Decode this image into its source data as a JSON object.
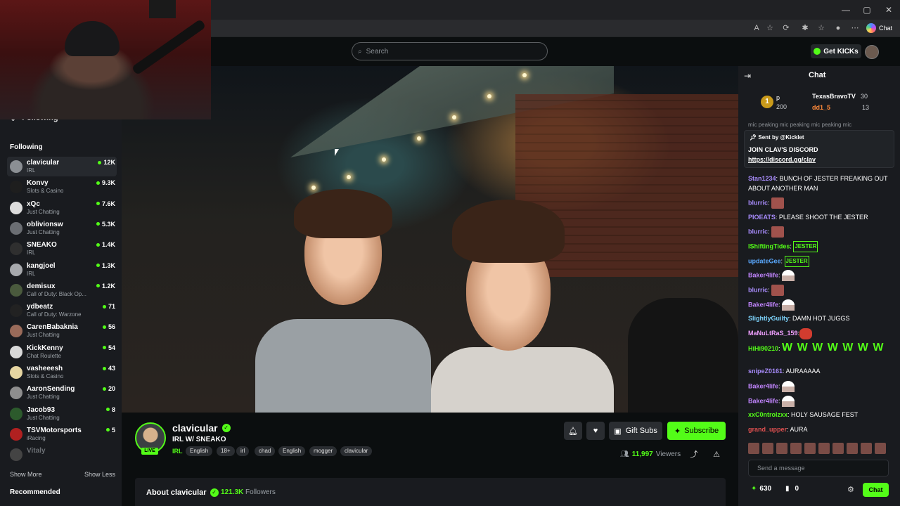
{
  "browser": {
    "window_controls": [
      "—",
      "▢",
      "✕"
    ],
    "chat_label": "Chat"
  },
  "header": {
    "search_placeholder": "Search",
    "get_kicks_label": "Get KICKs"
  },
  "sidebar": {
    "following_header": "Following",
    "following_title": "Following",
    "channels": [
      {
        "name": "clavicular",
        "category": "IRL",
        "viewers": "12K",
        "avatar_color": "#8b8f94"
      },
      {
        "name": "Konvy",
        "category": "Slots & Casino",
        "viewers": "9.3K",
        "avatar_color": "#1e1e1e"
      },
      {
        "name": "xQc",
        "category": "Just Chatting",
        "viewers": "7.6K",
        "avatar_color": "#dcdcdc"
      },
      {
        "name": "oblivionsw",
        "category": "Just Chatting",
        "viewers": "5.3K",
        "avatar_color": "#6b6e73"
      },
      {
        "name": "SNEAKO",
        "category": "IRL",
        "viewers": "1.4K",
        "avatar_color": "#2f2f2f"
      },
      {
        "name": "kangjoel",
        "category": "IRL",
        "viewers": "1.3K",
        "avatar_color": "#a7a9ad"
      },
      {
        "name": "demisux",
        "category": "Call of Duty: Black Op...",
        "viewers": "1.2K",
        "avatar_color": "#4a5a3d"
      },
      {
        "name": "ydbeatz",
        "category": "Call of Duty: Warzone",
        "viewers": "71",
        "avatar_color": "#222"
      },
      {
        "name": "CarenBabaknia",
        "category": "Just Chatting",
        "viewers": "56",
        "avatar_color": "#9a6b5a"
      },
      {
        "name": "KickKenny",
        "category": "Chat Roulette",
        "viewers": "54",
        "avatar_color": "#d9d9d9"
      },
      {
        "name": "vasheeesh",
        "category": "Slots & Casino",
        "viewers": "43",
        "avatar_color": "#e6d6a2"
      },
      {
        "name": "AaronSending",
        "category": "Just Chatting",
        "viewers": "20",
        "avatar_color": "#8e8e8e"
      },
      {
        "name": "Jacob93",
        "category": "Just Chatting",
        "viewers": "8",
        "avatar_color": "#2c5a2c"
      },
      {
        "name": "TSVMotorsports",
        "category": "iRacing",
        "viewers": "5",
        "avatar_color": "#b02020"
      },
      {
        "name": "Vitaly",
        "category": "",
        "viewers": "",
        "avatar_color": "#444"
      }
    ],
    "show_more": "Show More",
    "show_less": "Show Less",
    "recommended": "Recommended"
  },
  "stream": {
    "streamer": "clavicular",
    "live_label": "LIVE",
    "title": "IRL W/ SNEAKO",
    "category": "IRL",
    "tags": [
      "English",
      "18+",
      "irl",
      "chad",
      "English",
      "mogger",
      "clavicular"
    ],
    "gift_subs": "Gift Subs",
    "subscribe": "Subscribe",
    "viewer_count": "11,997",
    "viewer_label": "Viewers",
    "about": "About clavicular",
    "followers_count": "121.3K",
    "followers_label": "Followers"
  },
  "chat": {
    "title": "Chat",
    "leaderboard": {
      "rank": "1",
      "first_user": "p",
      "first_amount": "200",
      "second_user": "TexasBravoTV",
      "second_amount": "30",
      "third_user": "dd1_5",
      "third_amount": "13"
    },
    "peek_text": "mic peaking mic peaking mic peaking mic",
    "pinned": {
      "sent_by": "Sent by",
      "sender": "@Kicklet",
      "message": "JOIN CLAV'S DISCORD",
      "link": "https://discord.gg/clav"
    },
    "messages": [
      {
        "user": "Stan1234",
        "color": "#a78bfa",
        "text": "BUNCH OF JESTER FREAKING OUT ABOUT ANOTHER MAN",
        "emote": ""
      },
      {
        "user": "blurric",
        "color": "#a78bfa",
        "text": "",
        "emote": "red"
      },
      {
        "user": "PIOEATS",
        "color": "#a78bfa",
        "text": "PLEASE SHOOT THE JESTER",
        "emote": ""
      },
      {
        "user": "blurric",
        "color": "#a78bfa",
        "text": "",
        "emote": "red"
      },
      {
        "user": "IShiftingTides",
        "color": "#53fc18",
        "text": "",
        "emote": "jester"
      },
      {
        "user": "updateGee",
        "color": "#5aa9ff",
        "text": "",
        "emote": "jester"
      },
      {
        "user": "Baker4life",
        "color": "#c084fc",
        "text": "",
        "emote": "pale"
      },
      {
        "user": "blurric",
        "color": "#a78bfa",
        "text": "",
        "emote": "red"
      },
      {
        "user": "Baker4life",
        "color": "#c084fc",
        "text": "",
        "emote": "pale"
      },
      {
        "user": "SlightlyGuilty",
        "color": "#7dd3fc",
        "text": "DAMN HOT JUGGS",
        "emote": ""
      },
      {
        "user": "MaNuLtRaS_159",
        "color": "#f0a0ff",
        "text": "",
        "emote": "face"
      },
      {
        "user": "HiHi90210",
        "color": "#53fc18",
        "text": "W W W W W W W",
        "emote": "bigw"
      },
      {
        "user": "snipeZ0161",
        "color": "#a78bfa",
        "text": "AURAAAAA",
        "emote": ""
      },
      {
        "user": "Baker4life",
        "color": "#c084fc",
        "text": "",
        "emote": "pale"
      },
      {
        "user": "Baker4life",
        "color": "#c084fc",
        "text": "",
        "emote": "pale"
      },
      {
        "user": "xxC0ntrolzxx",
        "color": "#53fc18",
        "text": "HOLY SAUSAGE FEST",
        "emote": ""
      },
      {
        "user": "grand_upper",
        "color": "#e05050",
        "text": "AURA",
        "emote": ""
      }
    ],
    "jester_emote": "JESTER",
    "input_placeholder": "Send a message",
    "points": "630",
    "score": "0",
    "chat_button": "Chat"
  },
  "colors": {
    "accent": "#53fc18",
    "sidebar_bg": "#191b1f",
    "page_bg": "#0b0e0f"
  }
}
